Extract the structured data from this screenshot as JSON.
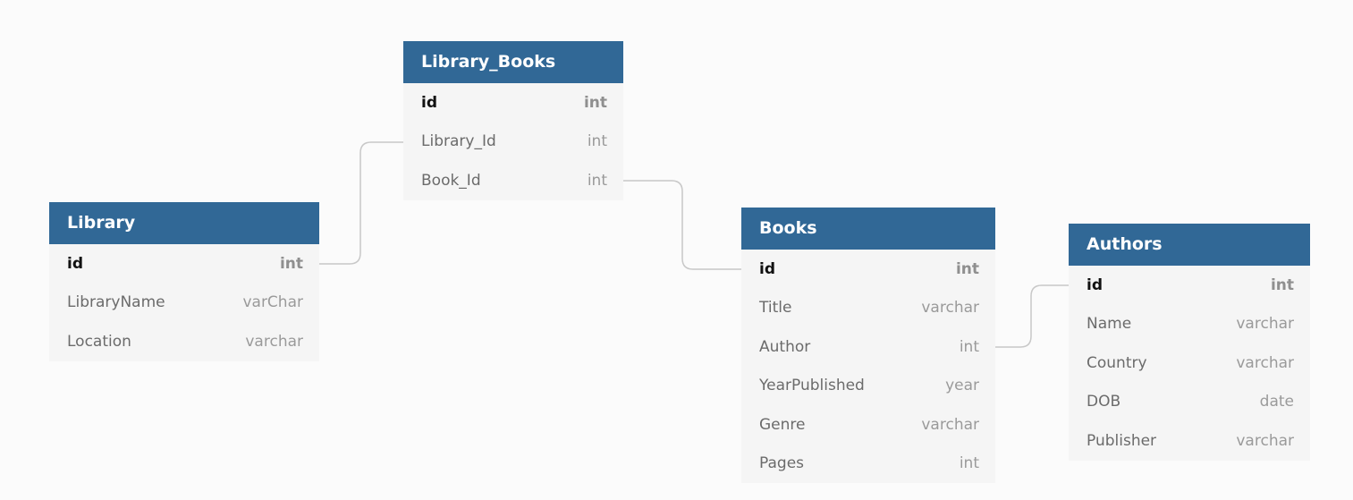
{
  "tables": {
    "library": {
      "name": "Library",
      "fields": [
        {
          "name": "id",
          "type": "int"
        },
        {
          "name": "LibraryName",
          "type": "varChar"
        },
        {
          "name": "Location",
          "type": "varchar"
        }
      ]
    },
    "library_books": {
      "name": "Library_Books",
      "fields": [
        {
          "name": "id",
          "type": "int"
        },
        {
          "name": "Library_Id",
          "type": "int"
        },
        {
          "name": "Book_Id",
          "type": "int"
        }
      ]
    },
    "books": {
      "name": "Books",
      "fields": [
        {
          "name": "id",
          "type": "int"
        },
        {
          "name": "Title",
          "type": "varchar"
        },
        {
          "name": "Author",
          "type": "int"
        },
        {
          "name": "YearPublished",
          "type": "year"
        },
        {
          "name": "Genre",
          "type": "varchar"
        },
        {
          "name": "Pages",
          "type": "int"
        }
      ]
    },
    "authors": {
      "name": "Authors",
      "fields": [
        {
          "name": "id",
          "type": "int"
        },
        {
          "name": "Name",
          "type": "varchar"
        },
        {
          "name": "Country",
          "type": "varchar"
        },
        {
          "name": "DOB",
          "type": "date"
        },
        {
          "name": "Publisher",
          "type": "varchar"
        }
      ]
    }
  },
  "colors": {
    "header": "#316896",
    "body": "#f5f5f5",
    "background": "#fbfbfb",
    "connector": "#c8c8c8"
  }
}
